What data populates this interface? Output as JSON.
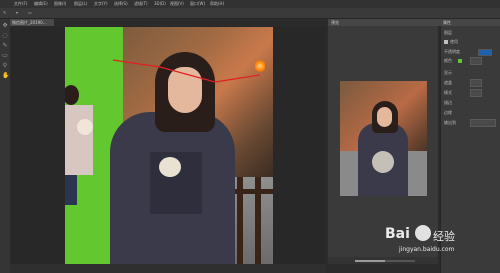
{
  "menubar": {
    "items": [
      "文件(F)",
      "编辑(E)",
      "图像(I)",
      "图层(L)",
      "文字(Y)",
      "选择(S)",
      "滤镜(T)",
      "3D(D)",
      "视图(V)",
      "窗口(W)",
      "帮助(H)"
    ]
  },
  "document": {
    "tab_label": "微信图片_20190..."
  },
  "panels": {
    "preview_tab": "预览",
    "properties_tab": "属性"
  },
  "properties": {
    "rows": [
      "图层",
      "使用",
      "不透明度",
      "颜色",
      "显示",
      "遮盖",
      "模式",
      "描边",
      "边缘",
      "输出到"
    ]
  },
  "colors": {
    "accent_green": "#63c72f",
    "selection_red": "#e02020"
  },
  "icons": [
    "move-icon",
    "lasso-icon",
    "brush-icon",
    "eraser-icon",
    "zoom-icon",
    "hand-icon"
  ],
  "watermark": {
    "brand": "Bai",
    "brand_suffix": "经验",
    "url": "jingyan.baidu.com"
  }
}
